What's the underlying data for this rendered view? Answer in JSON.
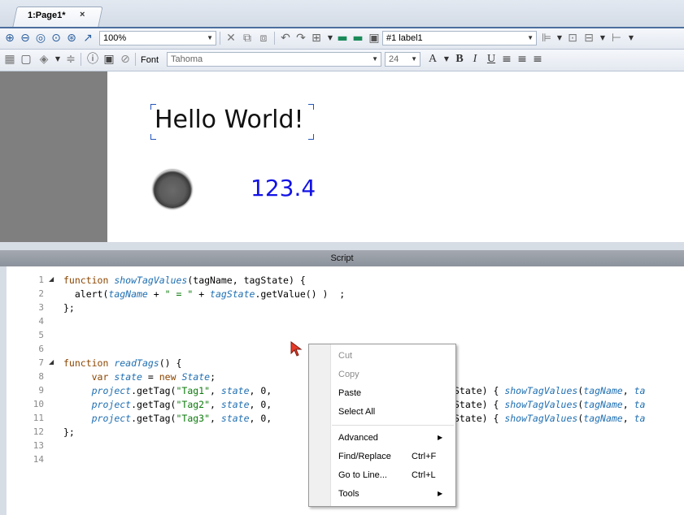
{
  "tab": {
    "label": "1:Page1*",
    "close": "×"
  },
  "toolbar1": {
    "zoom": "100%",
    "label_combo": "#1 label1"
  },
  "toolbar2": {
    "font_label": "Font",
    "font_name": "Tahoma",
    "font_size": "24"
  },
  "canvas": {
    "hello_text": "Hello World!",
    "value_text": "123.4"
  },
  "script": {
    "title": "Script",
    "line_numbers": [
      "1",
      "2",
      "3",
      "4",
      "5",
      "6",
      "7",
      "8",
      "9",
      "10",
      "11",
      "12",
      "13",
      "14"
    ]
  },
  "context_menu": {
    "cut": "Cut",
    "copy": "Copy",
    "paste": "Paste",
    "select_all": "Select All",
    "advanced": "Advanced",
    "find_replace": "Find/Replace",
    "find_replace_shortcut": "Ctrl+F",
    "go_to_line": "Go to Line...",
    "go_to_line_shortcut": "Ctrl+L",
    "tools": "Tools"
  },
  "colors": {
    "value_text": "#1212e6",
    "keyword": "#8b4500",
    "identifier_italic": "#1f6fb2",
    "string": "#0c7a0c"
  }
}
